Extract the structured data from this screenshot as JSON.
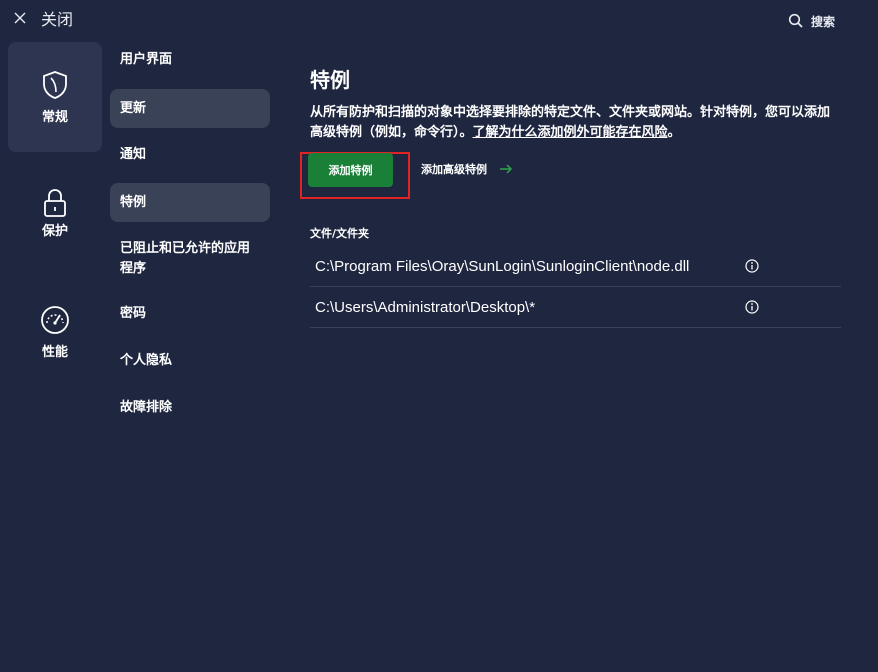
{
  "topbar": {
    "close_label": "关闭",
    "search_label": "搜索"
  },
  "categories": [
    {
      "label": "常规",
      "icon": "shield-icon",
      "active": true
    },
    {
      "label": "保护",
      "icon": "lock-icon",
      "active": false
    },
    {
      "label": "性能",
      "icon": "gauge-icon",
      "active": false
    }
  ],
  "subnav": [
    {
      "label": "用户界面"
    },
    {
      "label": "更新"
    },
    {
      "label": "通知"
    },
    {
      "label": "特例"
    },
    {
      "label": "已阻止和已允许的应用程序"
    },
    {
      "label": "密码"
    },
    {
      "label": "个人隐私"
    },
    {
      "label": "故障排除"
    }
  ],
  "main": {
    "title": "特例",
    "description": "从所有防护和扫描的对象中选择要排除的特定文件、文件夹或网站。针对特例，您可以添加高级特例（例如，命令行）。",
    "learn_more_link": "了解为什么添加例外可能存在风险",
    "learn_more_suffix": "。",
    "add_button": "添加特例",
    "add_advanced": "添加高级特例",
    "list_header": "文件/文件夹",
    "exceptions": [
      {
        "path": "C:\\Program Files\\Oray\\SunLogin\\SunloginClient\\node.dll"
      },
      {
        "path": "C:\\Users\\Administrator\\Desktop\\*"
      }
    ]
  },
  "colors": {
    "background": "#1f2740",
    "active_category": "#2d3550",
    "active_subnav": "#3a4258",
    "primary_button": "#1a7f37",
    "accent_arrow": "#2ea44f",
    "highlight": "#e02424"
  }
}
